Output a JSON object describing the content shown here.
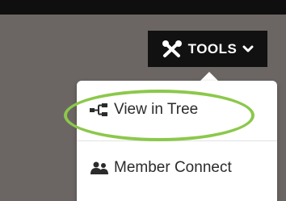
{
  "header": {
    "tools_label": "TOOLS",
    "tools_icon": "wrench-screwdriver-icon",
    "caret_icon": "chevron-down-icon"
  },
  "menu": {
    "items": [
      {
        "label": "View in Tree",
        "icon": "tree-icon"
      },
      {
        "label": "Member Connect",
        "icon": "members-icon"
      }
    ]
  },
  "colors": {
    "topbar": "#0f0f0f",
    "backdrop": "#6b6663",
    "button_bg": "#111111",
    "highlight_ring": "#8cc84b"
  }
}
